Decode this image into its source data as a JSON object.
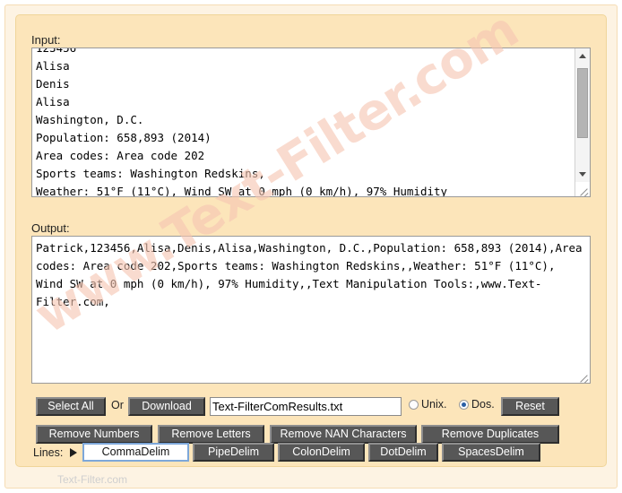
{
  "watermark": {
    "diagonal_text": "www.Text-Filter.com",
    "footer_text": "Text-Filter.com",
    "color": "#f6c6b2"
  },
  "input_section": {
    "label": "Input:",
    "value": "123456\nAlisa\nDenis\nAlisa\nWashington, D.C.\nPopulation: 658,893 (2014)\nArea codes: Area code 202\nSports teams: Washington Redskins,\nWeather: 51°F (11°C), Wind SW at 0 mph (0 km/h), 97% Humidity\n\nText Manipulation Tools:"
  },
  "output_section": {
    "label": "Output:",
    "value": "Patrick,123456,Alisa,Denis,Alisa,Washington, D.C.,Population: 658,893 (2014),Area codes: Area code 202,Sports teams: Washington Redskins,,Weather: 51°F (11°C), Wind SW at 0 mph (0 km/h), 97% Humidity,,Text Manipulation Tools:,www.Text-Filter.com,"
  },
  "action_row": {
    "select_all_label": "Select All",
    "or_label": "Or",
    "download_label": "Download",
    "filename_value": "Text-FilterComResults.txt",
    "unix_label": "Unix.",
    "unix_checked": false,
    "dos_label": "Dos.",
    "dos_checked": true,
    "reset_label": "Reset"
  },
  "remove_row": {
    "remove_numbers_label": "Remove Numbers",
    "remove_letters_label": "Remove Letters",
    "remove_nan_label": "Remove NAN Characters",
    "remove_duplicates_label": "Remove Duplicates"
  },
  "delim_row": {
    "lines_label": "Lines:",
    "comma_label": "CommaDelim",
    "pipe_label": "PipeDelim",
    "colon_label": "ColonDelim",
    "dot_label": "DotDelim",
    "spaces_label": "SpacesDelim",
    "active": "CommaDelim",
    "active_border_color": "#7da7d9"
  }
}
